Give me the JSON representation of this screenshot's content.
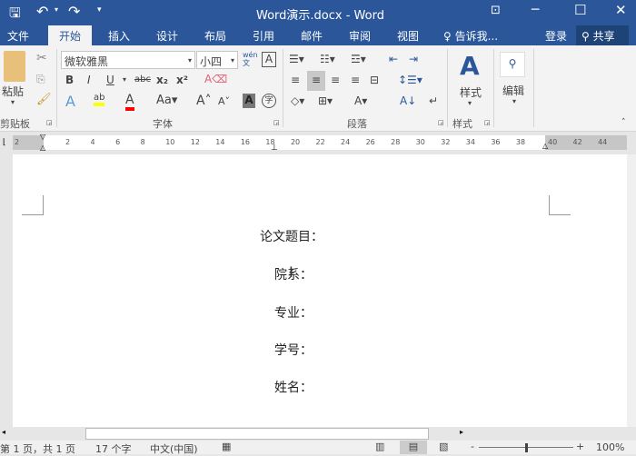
{
  "title": "Word演示.docx - Word",
  "quick_access": [
    "save-icon",
    "undo-icon",
    "redo-icon",
    "customize-icon"
  ],
  "window_controls": [
    "ribbon-display-icon",
    "minimize-icon",
    "maximize-icon",
    "close-icon"
  ],
  "tabs": [
    {
      "label": "文件"
    },
    {
      "label": "开始"
    },
    {
      "label": "插入"
    },
    {
      "label": "设计"
    },
    {
      "label": "布局"
    },
    {
      "label": "引用"
    },
    {
      "label": "邮件"
    },
    {
      "label": "审阅"
    },
    {
      "label": "视图"
    }
  ],
  "tell_me": "告诉我...",
  "signin": "登录",
  "share": "共享",
  "ribbon": {
    "clipboard": {
      "label": "剪贴板",
      "paste": "粘贴"
    },
    "font": {
      "label": "字体",
      "font_name": "微软雅黑",
      "font_size": "小四",
      "phonetic": "wén\n文"
    },
    "paragraph": {
      "label": "段落"
    },
    "styles": {
      "label": "样式",
      "button": "样式"
    },
    "editing": {
      "button": "编辑"
    }
  },
  "ruler": {
    "left_margin": [
      "2"
    ],
    "ticks": [
      "2",
      "4",
      "6",
      "8",
      "10",
      "12",
      "14",
      "16",
      "18",
      "20",
      "22",
      "24",
      "26",
      "28",
      "30",
      "32",
      "34",
      "36",
      "38"
    ],
    "right_margin": [
      "40",
      "42",
      "44"
    ]
  },
  "document": {
    "lines": [
      "论文题目：",
      "院系：",
      "专业：",
      "学号：",
      "姓名："
    ]
  },
  "status": {
    "page": "第 1 页，共 1 页",
    "words": "17 个字",
    "language": "中文(中国)",
    "zoom": "100%",
    "zoom_level": 100
  },
  "colors": {
    "brand": "#2b579a",
    "highlight": "#ffff00",
    "font_color": "#ff0000"
  }
}
